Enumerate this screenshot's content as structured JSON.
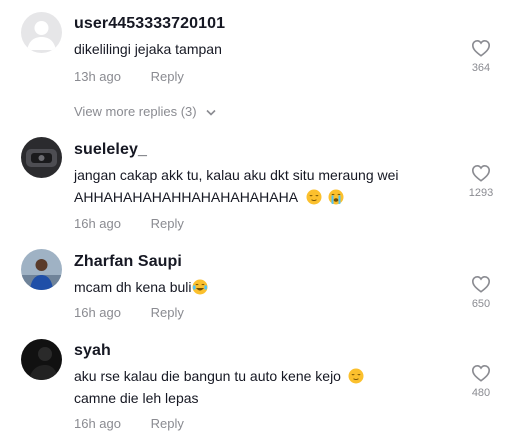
{
  "comments": [
    {
      "username": "user4453333720101",
      "lines": [
        "dikelilingi jejaka tampan"
      ],
      "time": "13h ago",
      "reply_label": "Reply",
      "likes": "364",
      "avatar": "default-avatar"
    },
    {
      "username": "sueleley_",
      "lines": [
        "jangan cakap akk tu, kalau aku dkt situ meraung wei",
        "AHHAHAHAHAHHAHAHAHAHAHA"
      ],
      "time": "16h ago",
      "reply_label": "Reply",
      "likes": "1293",
      "emojis": [
        "relieved-face",
        "loudly-crying-face"
      ]
    },
    {
      "username": "Zharfan Saupi",
      "lines": [
        "mcam dh kena buli"
      ],
      "time": "16h ago",
      "reply_label": "Reply",
      "likes": "650",
      "emojis": [
        "tears-of-joy-face"
      ]
    },
    {
      "username": "syah",
      "lines": [
        "aku rse kalau die bangun tu auto kene kejo",
        "camne die leh lepas"
      ],
      "time": "16h ago",
      "reply_label": "Reply",
      "likes": "480",
      "emojis": [
        "relieved-face"
      ]
    }
  ],
  "view_more_replies": "View more replies (3)",
  "colors": {
    "text": "#161823",
    "muted": "#8a8b91",
    "background": "#ffffff"
  }
}
